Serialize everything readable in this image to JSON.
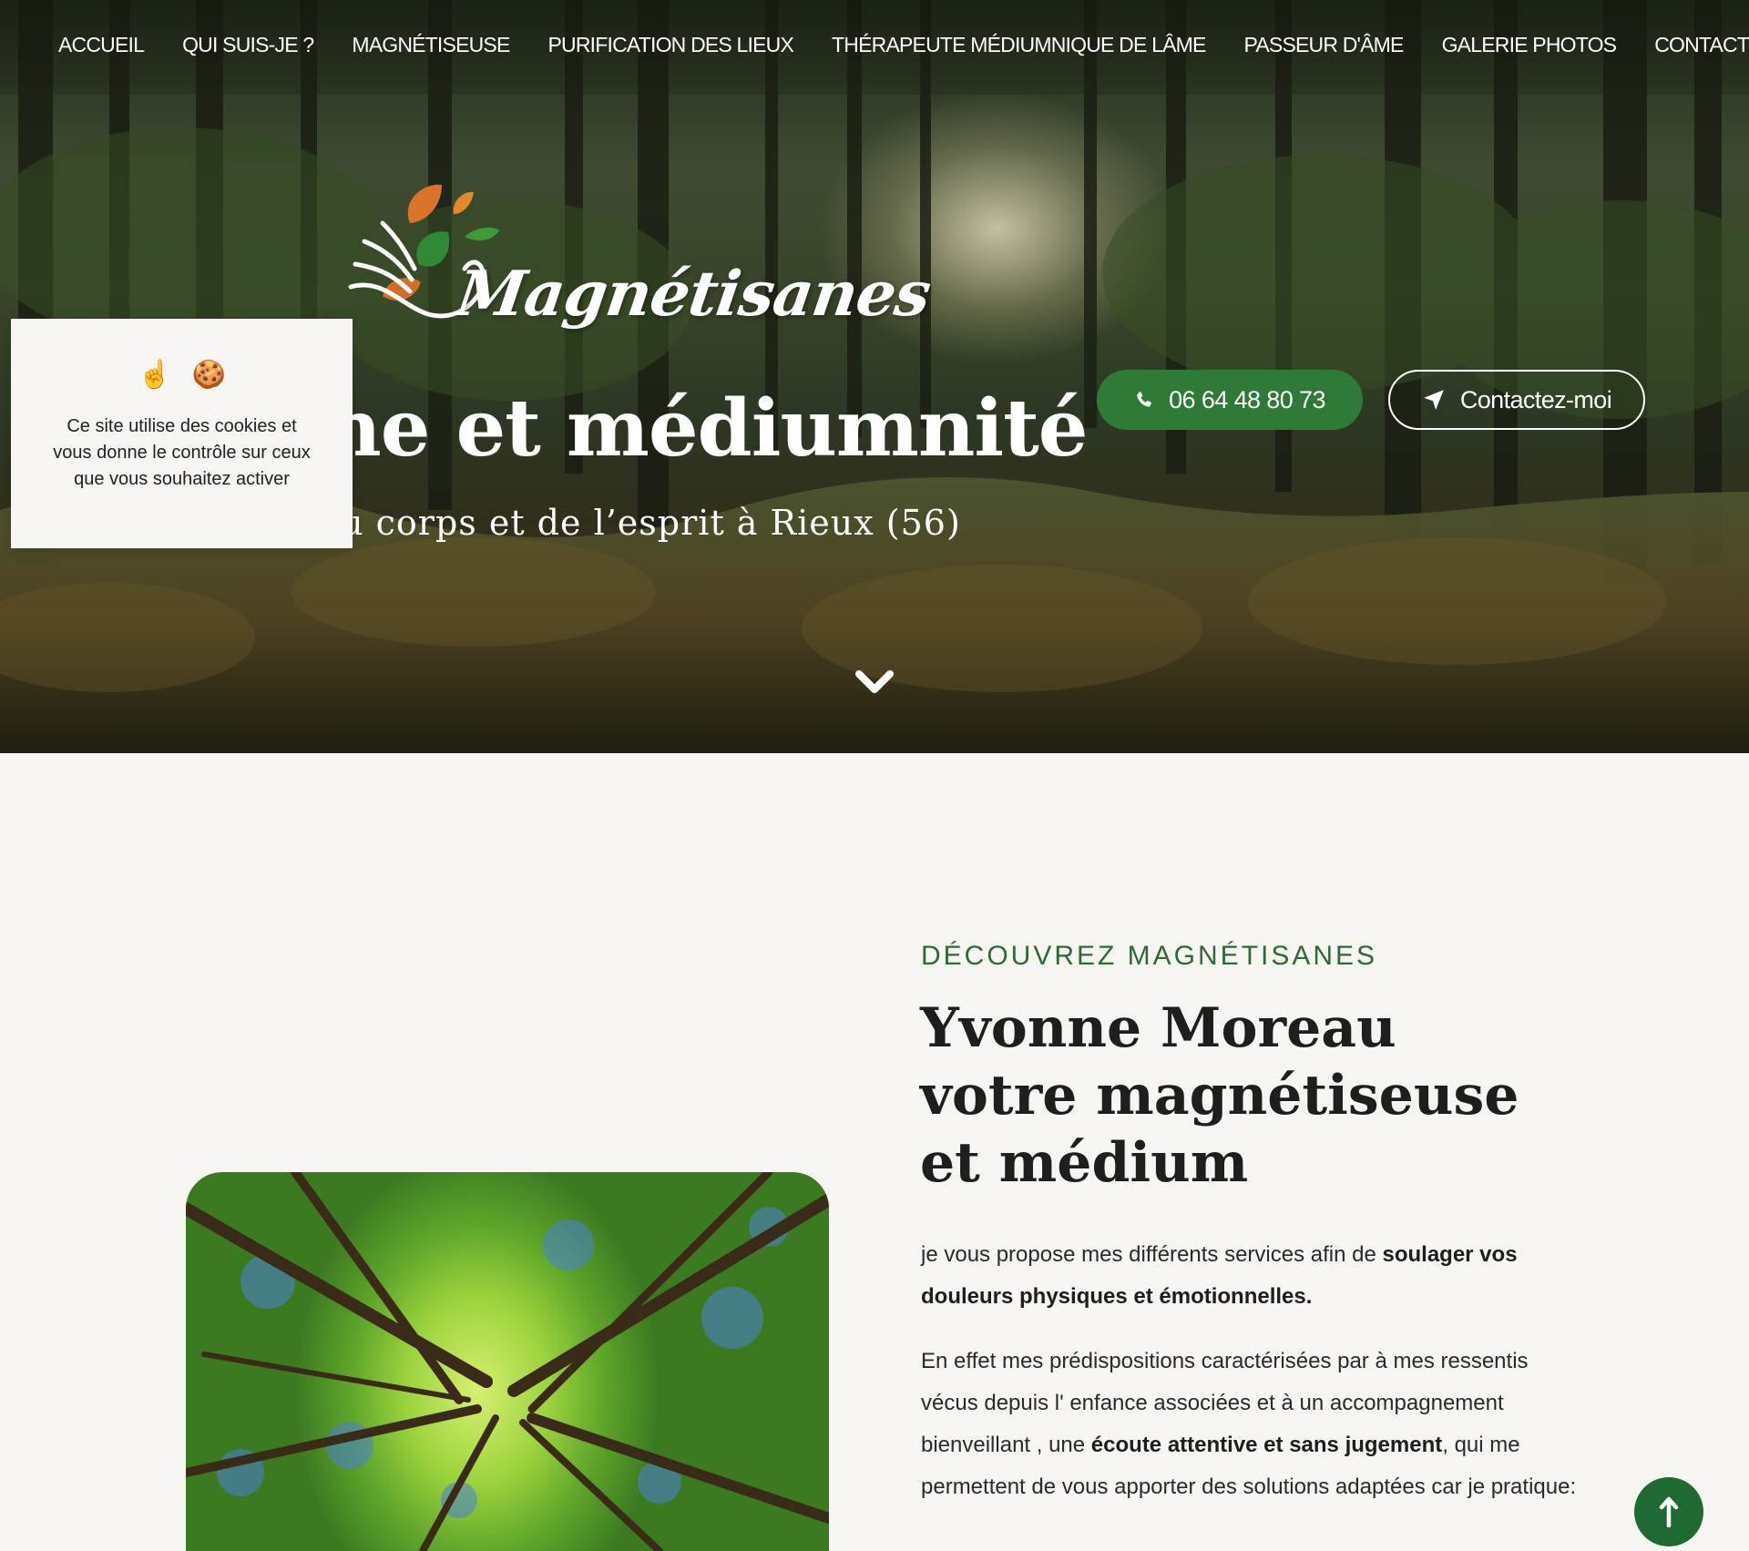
{
  "nav": {
    "items": [
      {
        "label": "ACCUEIL"
      },
      {
        "label": "QUI SUIS-JE ?"
      },
      {
        "label": "MAGNÉTISEUSE"
      },
      {
        "label": "PURIFICATION DES LIEUX"
      },
      {
        "label": "THÉRAPEUTE MÉDIUMNIQUE DE LÂME"
      },
      {
        "label": "PASSEUR D'ÂME"
      },
      {
        "label": "GALERIE PHOTOS"
      },
      {
        "label": "CONTACT"
      }
    ]
  },
  "hero": {
    "logo_text": "Magnétisanes",
    "title": "tisme et médiumnité",
    "subtitle": "es maux du corps et de l’esprit à Rieux (56)",
    "phone_label": "06 64 48 80 73",
    "contact_label": "Contactez-moi",
    "phone_icon": "phone-icon",
    "contact_icon": "send-arrow-icon",
    "scroll_icon": "chevron-down-icon"
  },
  "cookie": {
    "emojis": [
      "☝️",
      "🍪"
    ],
    "text": "Ce site utilise des cookies et vous donne le contrôle sur ceux que vous souhaitez activer"
  },
  "about": {
    "eyebrow": "DÉCOUVREZ MAGNÉTISANES",
    "title": "Yvonne Moreau votre magnétiseuse et médium",
    "p1": {
      "t1": "je vous propose mes différents services afin de ",
      "b1": "soulager vos douleurs physiques et émotionnelles."
    },
    "p2": {
      "t1": "En effet mes prédispositions caractérisées par à mes ressentis vécus depuis l' enfance  associées et à un accompagnement bienveillant , une ",
      "b1": "écoute attentive et sans jugement",
      "t2": ", qui me permettent de vous apporter des solutions adaptées  car je pratique:"
    }
  },
  "back_to_top_icon": "arrow-up-icon",
  "colors": {
    "brand_green": "#2e7a36",
    "eyebrow_green": "#2e6b34",
    "page_bg": "#f7f5f2"
  }
}
